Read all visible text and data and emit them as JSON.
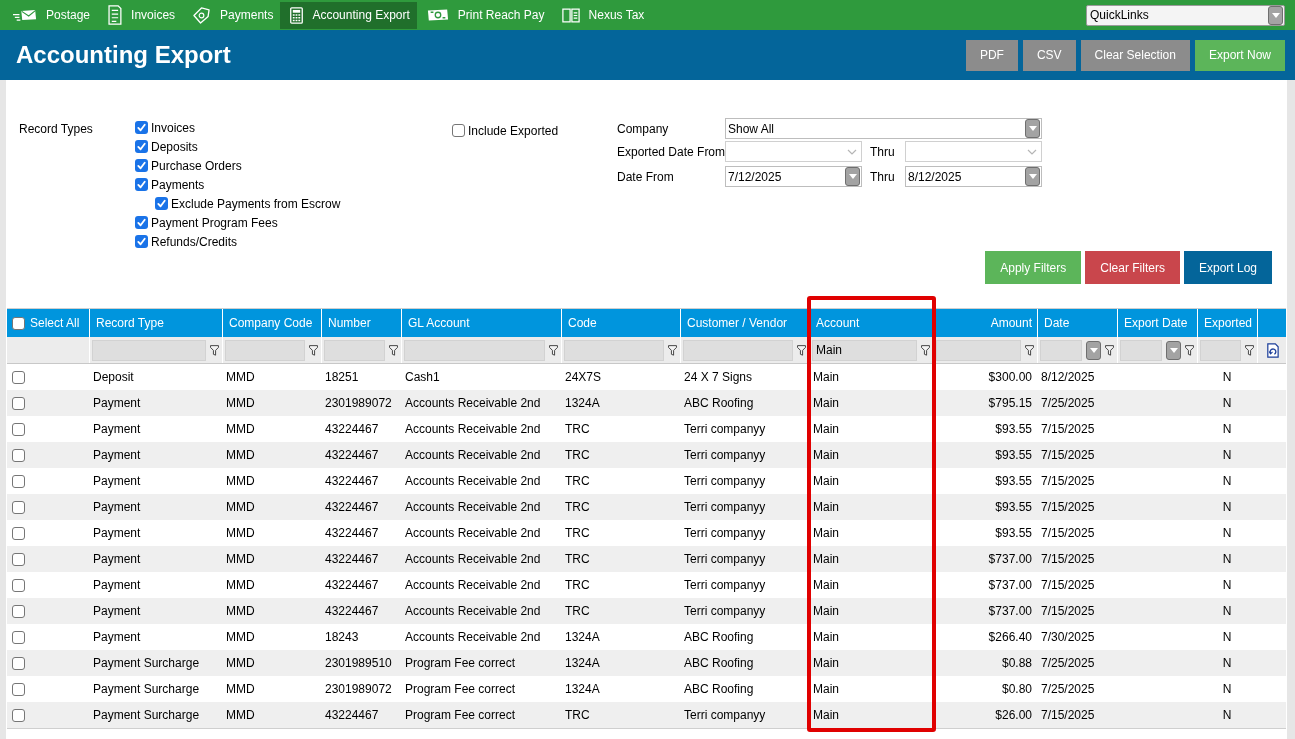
{
  "nav": {
    "items": [
      {
        "label": "Postage",
        "selected": false
      },
      {
        "label": "Invoices",
        "selected": false
      },
      {
        "label": "Payments",
        "selected": false
      },
      {
        "label": "Accounting Export",
        "selected": true
      },
      {
        "label": "Print Reach Pay",
        "selected": false
      },
      {
        "label": "Nexus Tax",
        "selected": false
      }
    ],
    "quick_links": {
      "value": "QuickLinks"
    }
  },
  "header": {
    "title": "Accounting Export",
    "buttons": [
      {
        "label": "PDF",
        "kind": "neutral"
      },
      {
        "label": "CSV",
        "kind": "neutral"
      },
      {
        "label": "Clear Selection",
        "kind": "neutral"
      },
      {
        "label": "Export Now",
        "kind": "success"
      }
    ]
  },
  "filters": {
    "record_types": {
      "label": "Record Types",
      "options": [
        {
          "label": "Invoices",
          "checked": true
        },
        {
          "label": "Deposits",
          "checked": true
        },
        {
          "label": "Purchase Orders",
          "checked": true
        },
        {
          "label": "Payments",
          "checked": true,
          "children": [
            {
              "label": "Exclude Payments from Escrow",
              "checked": true
            }
          ]
        },
        {
          "label": "Payment Program Fees",
          "checked": true
        },
        {
          "label": "Refunds/Credits",
          "checked": true
        }
      ]
    },
    "include_exported": {
      "label": "Include Exported",
      "checked": false
    },
    "company": {
      "label": "Company",
      "value": "Show All"
    },
    "exported_date": {
      "label": "Exported Date From",
      "thru_label": "Thru"
    },
    "date": {
      "label": "Date From",
      "from": "7/12/2025",
      "thru_label": "Thru",
      "thru": "8/12/2025"
    },
    "buttons": [
      {
        "label": "Apply Filters",
        "kind": "success"
      },
      {
        "label": "Clear Filters",
        "kind": "danger"
      },
      {
        "label": "Export Log",
        "kind": "info"
      }
    ]
  },
  "table": {
    "select_all": {
      "label": "Select All",
      "checked": false
    },
    "columns": [
      {
        "label": "Record Type",
        "kind": "text",
        "highlighted": false
      },
      {
        "label": "Company Code",
        "kind": "text",
        "highlighted": false
      },
      {
        "label": "Number",
        "kind": "text",
        "highlighted": false
      },
      {
        "label": "GL Account",
        "kind": "text",
        "highlighted": false
      },
      {
        "label": "Code",
        "kind": "text",
        "highlighted": false
      },
      {
        "label": "Customer / Vendor",
        "kind": "text",
        "highlighted": false
      },
      {
        "label": "Account",
        "kind": "text",
        "filter_value": "Main",
        "highlighted": true
      },
      {
        "label": "Amount",
        "kind": "amount",
        "highlighted": false
      },
      {
        "label": "Date",
        "kind": "date",
        "highlighted": false
      },
      {
        "label": "Export Date",
        "kind": "date",
        "highlighted": false
      },
      {
        "label": "Exported",
        "kind": "flag",
        "highlighted": false
      }
    ],
    "rows": [
      {
        "checked": false,
        "record_type": "Deposit",
        "company_code": "MMD",
        "number": "18251",
        "gl_account": "Cash1",
        "code": "24X7S",
        "customer_vendor": "24 X 7 Signs",
        "account": "Main",
        "amount": "$300.00",
        "date": "8/12/2025",
        "exported": "N"
      },
      {
        "checked": false,
        "record_type": "Payment",
        "company_code": "MMD",
        "number": "2301989072",
        "gl_account": "Accounts Receivable 2nd",
        "code": "1324A",
        "customer_vendor": "ABC Roofing",
        "account": "Main",
        "amount": "$795.15",
        "date": "7/25/2025",
        "exported": "N"
      },
      {
        "checked": false,
        "record_type": "Payment",
        "company_code": "MMD",
        "number": "43224467",
        "gl_account": "Accounts Receivable 2nd",
        "code": "TRC",
        "customer_vendor": "Terri companyy",
        "account": "Main",
        "amount": "$93.55",
        "date": "7/15/2025",
        "exported": "N"
      },
      {
        "checked": false,
        "record_type": "Payment",
        "company_code": "MMD",
        "number": "43224467",
        "gl_account": "Accounts Receivable 2nd",
        "code": "TRC",
        "customer_vendor": "Terri companyy",
        "account": "Main",
        "amount": "$93.55",
        "date": "7/15/2025",
        "exported": "N"
      },
      {
        "checked": false,
        "record_type": "Payment",
        "company_code": "MMD",
        "number": "43224467",
        "gl_account": "Accounts Receivable 2nd",
        "code": "TRC",
        "customer_vendor": "Terri companyy",
        "account": "Main",
        "amount": "$93.55",
        "date": "7/15/2025",
        "exported": "N"
      },
      {
        "checked": false,
        "record_type": "Payment",
        "company_code": "MMD",
        "number": "43224467",
        "gl_account": "Accounts Receivable 2nd",
        "code": "TRC",
        "customer_vendor": "Terri companyy",
        "account": "Main",
        "amount": "$93.55",
        "date": "7/15/2025",
        "exported": "N"
      },
      {
        "checked": false,
        "record_type": "Payment",
        "company_code": "MMD",
        "number": "43224467",
        "gl_account": "Accounts Receivable 2nd",
        "code": "TRC",
        "customer_vendor": "Terri companyy",
        "account": "Main",
        "amount": "$93.55",
        "date": "7/15/2025",
        "exported": "N"
      },
      {
        "checked": false,
        "record_type": "Payment",
        "company_code": "MMD",
        "number": "43224467",
        "gl_account": "Accounts Receivable 2nd",
        "code": "TRC",
        "customer_vendor": "Terri companyy",
        "account": "Main",
        "amount": "$737.00",
        "date": "7/15/2025",
        "exported": "N"
      },
      {
        "checked": false,
        "record_type": "Payment",
        "company_code": "MMD",
        "number": "43224467",
        "gl_account": "Accounts Receivable 2nd",
        "code": "TRC",
        "customer_vendor": "Terri companyy",
        "account": "Main",
        "amount": "$737.00",
        "date": "7/15/2025",
        "exported": "N"
      },
      {
        "checked": false,
        "record_type": "Payment",
        "company_code": "MMD",
        "number": "43224467",
        "gl_account": "Accounts Receivable 2nd",
        "code": "TRC",
        "customer_vendor": "Terri companyy",
        "account": "Main",
        "amount": "$737.00",
        "date": "7/15/2025",
        "exported": "N"
      },
      {
        "checked": false,
        "record_type": "Payment",
        "company_code": "MMD",
        "number": "18243",
        "gl_account": "Accounts Receivable 2nd",
        "code": "1324A",
        "customer_vendor": "ABC Roofing",
        "account": "Main",
        "amount": "$266.40",
        "date": "7/30/2025",
        "exported": "N"
      },
      {
        "checked": false,
        "record_type": "Payment Surcharge",
        "company_code": "MMD",
        "number": "2301989510",
        "gl_account": "Program Fee correct",
        "code": "1324A",
        "customer_vendor": "ABC Roofing",
        "account": "Main",
        "amount": "$0.88",
        "date": "7/25/2025",
        "exported": "N"
      },
      {
        "checked": false,
        "record_type": "Payment Surcharge",
        "company_code": "MMD",
        "number": "2301989072",
        "gl_account": "Program Fee correct",
        "code": "1324A",
        "customer_vendor": "ABC Roofing",
        "account": "Main",
        "amount": "$0.80",
        "date": "7/25/2025",
        "exported": "N"
      },
      {
        "checked": false,
        "record_type": "Payment Surcharge",
        "company_code": "MMD",
        "number": "43224467",
        "gl_account": "Program Fee correct",
        "code": "TRC",
        "customer_vendor": "Terri companyy",
        "account": "Main",
        "amount": "$26.00",
        "date": "7/15/2025",
        "exported": "N"
      }
    ]
  }
}
